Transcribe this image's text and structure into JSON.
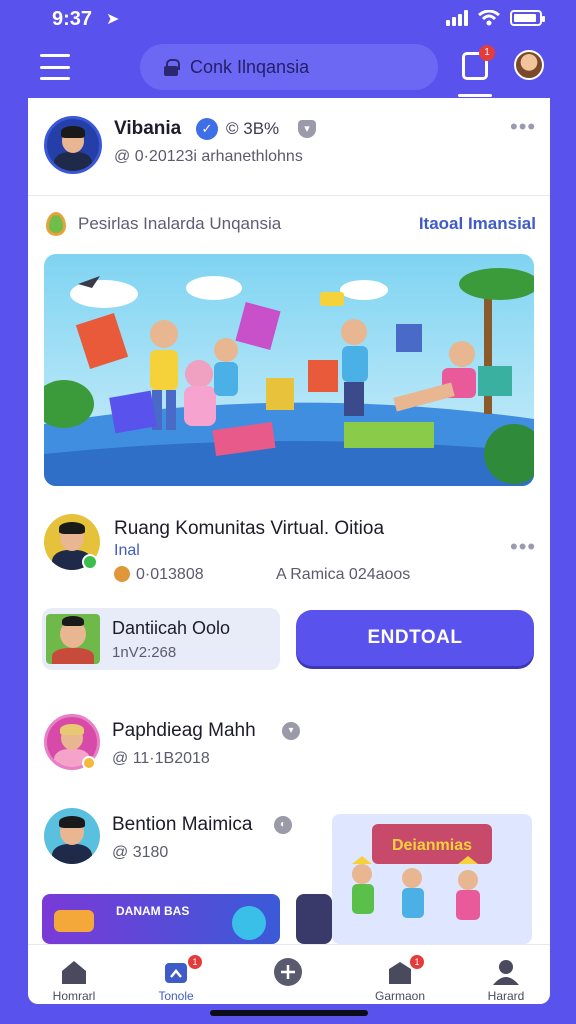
{
  "status_bar": {
    "time": "9:37"
  },
  "top_bar": {
    "search_text": "Conk Ilnqansia",
    "notification_badge": "1"
  },
  "post": {
    "author_name": "Vibania",
    "stat": "© 3B%",
    "handle": "@  0·20123i arhanethlohns",
    "location_text": "Pesirlas Inalarda Unqansia",
    "location_link": "Itaoal Imansial"
  },
  "community": {
    "title": "Ruang Komunitas Virtual. Oitioa",
    "subtitle": "Inal",
    "stat_left": "0·013808",
    "stat_right": "A Ramica 024aoos"
  },
  "channel": {
    "name": "Dantiicah Oolo",
    "code": "1nV2:268",
    "join_label": "ENDTOAL"
  },
  "users": [
    {
      "name": "Paphdieag Mahh",
      "handle": "@ 11·1B2018"
    },
    {
      "name": "Bention Maimica",
      "handle": "@ 3180"
    }
  ],
  "promo": {
    "tile_left_text": "DANAM BAS",
    "tile_right_title": "Deianmias"
  },
  "bottom_nav": {
    "items": [
      {
        "label": "Homrarl",
        "icon": "home-icon"
      },
      {
        "label": "Tonole",
        "icon": "community-icon",
        "badge": "1"
      },
      {
        "label": "",
        "icon": "create-icon"
      },
      {
        "label": "Garmaon",
        "icon": "games-icon",
        "badge": "1"
      },
      {
        "label": "Harard",
        "icon": "profile-icon"
      }
    ]
  },
  "colors": {
    "brand": "#5a52ec",
    "link": "#3f5bc8",
    "badge": "#e63b3b"
  }
}
